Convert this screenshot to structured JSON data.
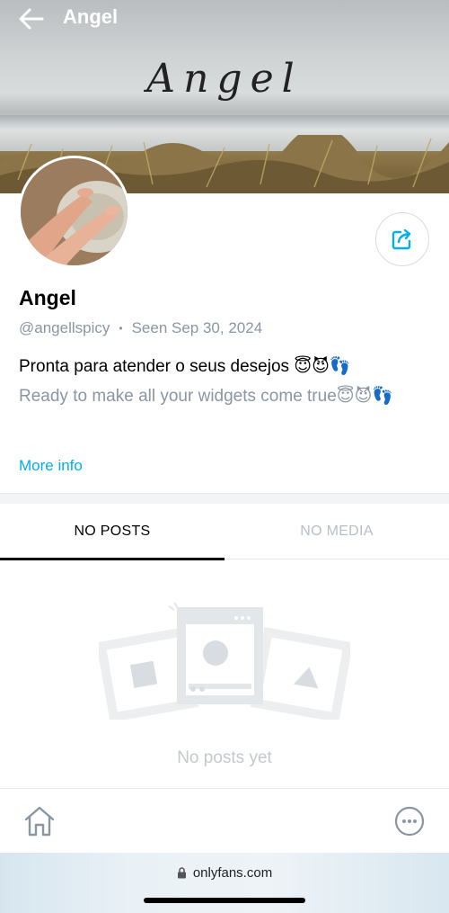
{
  "header": {
    "title": "Angel",
    "banner_text": "Angel"
  },
  "profile": {
    "name": "Angel",
    "handle": "@angellspicy",
    "separator": "•",
    "seen": "Seen  Sep 30, 2024",
    "bio_line1": "Pronta para atender o seus desejos 😇😈👣",
    "bio_line2": "Ready to make all your widgets come true😇😈👣",
    "more_info": "More info"
  },
  "tabs": [
    {
      "label": "NO POSTS",
      "active": true
    },
    {
      "label": "NO MEDIA",
      "active": false
    }
  ],
  "empty_state": {
    "text": "No posts yet"
  },
  "browser": {
    "url": "onlyfans.com"
  },
  "icons": {
    "back": "arrow-left-icon",
    "share": "share-icon",
    "home": "home-icon",
    "more": "more-dots-icon",
    "lock": "lock-icon"
  },
  "colors": {
    "accent": "#00aff0",
    "muted": "#8a96a3"
  }
}
